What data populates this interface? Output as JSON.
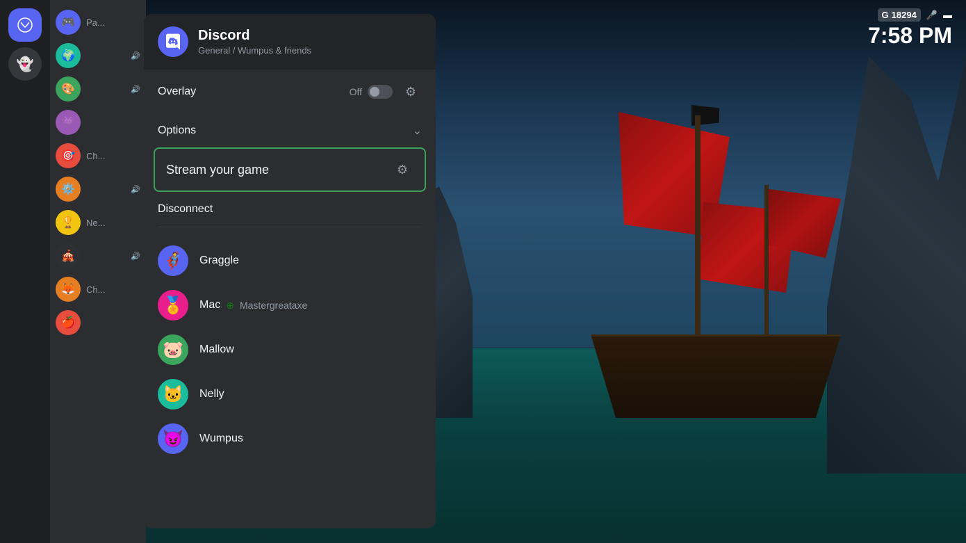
{
  "background": {
    "type": "game-scene",
    "description": "Sea of Thieves pirate ship scene"
  },
  "status_bar": {
    "g_label": "G",
    "score": "18294",
    "mic_icon": "🎤",
    "battery_icon": "🔋",
    "time": "7:58 PM"
  },
  "sidebar": {
    "icon_items": [
      {
        "id": "xbox",
        "emoji": "⊕",
        "active": true
      },
      {
        "id": "ghost",
        "emoji": "👻",
        "active": false
      }
    ],
    "channels": [
      {
        "label": "Pa...",
        "avatar_emoji": "🎮",
        "av_class": "av-blue",
        "has_volume": false
      },
      {
        "label": "",
        "avatar_emoji": "🌍",
        "av_class": "av-teal",
        "has_volume": true
      },
      {
        "label": "",
        "avatar_emoji": "🎨",
        "av_class": "av-green",
        "has_volume": true
      },
      {
        "label": "",
        "avatar_emoji": "👾",
        "av_class": "av-purple",
        "has_volume": false
      },
      {
        "label": "Ch...",
        "avatar_emoji": "🎯",
        "av_class": "av-red",
        "has_volume": false
      },
      {
        "label": "",
        "avatar_emoji": "⚙️",
        "av_class": "av-orange",
        "has_volume": true
      },
      {
        "label": "Ne...",
        "avatar_emoji": "🏆",
        "av_class": "av-yellow",
        "has_volume": false
      },
      {
        "label": "",
        "avatar_emoji": "🎪",
        "av_class": "av-dark",
        "has_volume": true
      },
      {
        "label": "Ch...",
        "avatar_emoji": "🦊",
        "av_class": "av-orange",
        "has_volume": false
      },
      {
        "label": "",
        "avatar_emoji": "🍎",
        "av_class": "av-red",
        "has_volume": false
      }
    ]
  },
  "discord_panel": {
    "app_name": "Discord",
    "channel_path": "General / Wumpus & friends",
    "overlay": {
      "label": "Overlay",
      "toggle_state": "Off",
      "gear_icon": "⚙"
    },
    "options": {
      "label": "Options",
      "chevron_icon": "⌄"
    },
    "stream_game": {
      "label": "Stream your game",
      "gear_icon": "⚙",
      "highlighted": true
    },
    "disconnect": {
      "label": "Disconnect"
    },
    "users": [
      {
        "name": "Graggle",
        "avatar_emoji": "🦸",
        "av_class": "av-blue",
        "has_xbox": false,
        "gamertag": ""
      },
      {
        "name": "Mac",
        "avatar_emoji": "🏅",
        "av_class": "av-pink",
        "has_xbox": true,
        "gamertag": "Mastergreataxe"
      },
      {
        "name": "Mallow",
        "avatar_emoji": "🐷",
        "av_class": "av-green",
        "has_xbox": false,
        "gamertag": ""
      },
      {
        "name": "Nelly",
        "avatar_emoji": "🐱",
        "av_class": "av-teal",
        "has_xbox": false,
        "gamertag": ""
      },
      {
        "name": "Wumpus",
        "avatar_emoji": "😈",
        "av_class": "av-blue",
        "has_xbox": false,
        "gamertag": ""
      }
    ]
  }
}
